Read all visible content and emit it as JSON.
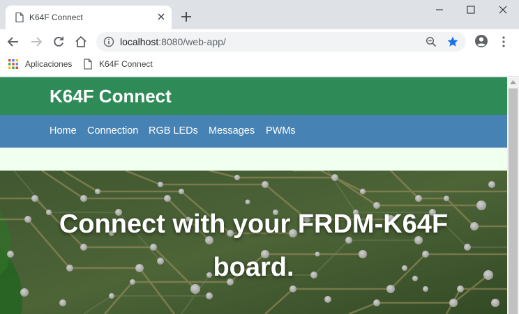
{
  "browser": {
    "tab": {
      "title": "K64F Connect",
      "icon": "page-icon",
      "close_icon": "close-icon"
    },
    "new_tab_icon": "plus-icon",
    "window_controls": [
      "minimize-icon",
      "maximize-icon",
      "close-icon"
    ],
    "toolbar": {
      "back_icon": "arrow-left-icon",
      "forward_icon": "arrow-right-icon",
      "reload_icon": "reload-icon",
      "home_icon": "home-icon",
      "address": {
        "host": "localhost",
        "rest": ":8080/web-app/"
      },
      "zoom_icon": "zoom-out-icon",
      "bookmark_icon": "star-icon",
      "account_icon": "account-icon",
      "menu_icon": "vertical-dots-icon"
    },
    "bookmarks": [
      {
        "label": "Aplicaciones",
        "icon": "apps-grid-icon"
      },
      {
        "label": "K64F Connect",
        "icon": "page-icon"
      }
    ]
  },
  "site": {
    "title": "K64F Connect",
    "nav": [
      "Home",
      "Connection",
      "RGB LEDs",
      "Messages",
      "PWMs"
    ],
    "hero": {
      "line1": "Connect with your FRDM-K64F",
      "line2": "board."
    },
    "colors": {
      "header": "#2e8b57",
      "nav": "#4682b4",
      "spacer": "#f0fff0"
    }
  }
}
